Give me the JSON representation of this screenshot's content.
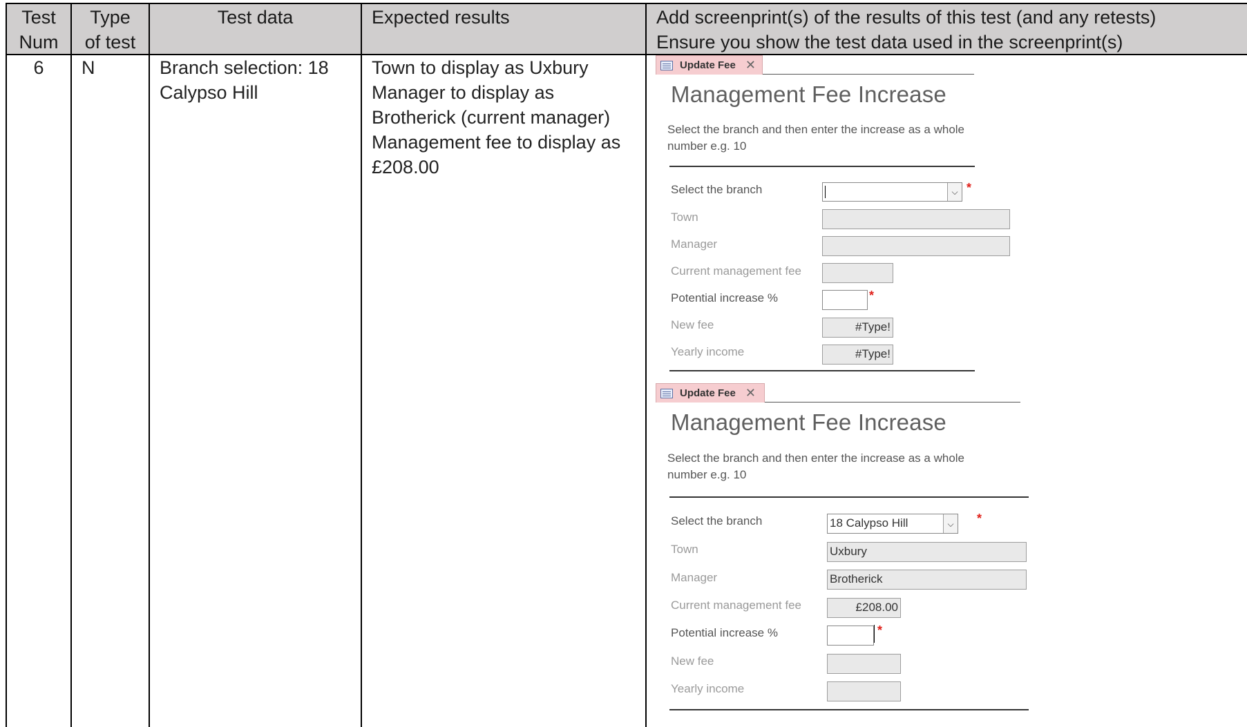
{
  "table": {
    "headers": {
      "test_num_line1": "Test",
      "test_num_line2": "Num",
      "type_line1": "Type",
      "type_line2": "of test",
      "test_data": "Test data",
      "expected_results": "Expected results",
      "screenprint_line1": "Add screenprint(s) of the results of this test (and any retests)",
      "screenprint_line2": "Ensure you show the test data used in the screenprint(s)"
    },
    "row": {
      "test_num": "6",
      "type": "N",
      "test_data_line1": "Branch selection: 18",
      "test_data_line2": "Calypso Hill",
      "expected_line1": "Town to display as Uxbury",
      "expected_line2": "Manager to display as",
      "expected_line3": "Brotherick (current manager)",
      "expected_line4": "Management fee to display as",
      "expected_line5": "£208.00"
    }
  },
  "screenshot1": {
    "tab_label": "Update Fee",
    "title": "Management Fee Increase",
    "desc_line1": "Select the branch and then enter the increase as a whole",
    "desc_line2": "number e.g. 10",
    "labels": {
      "branch": "Select the branch",
      "town": "Town",
      "manager": "Manager",
      "current_fee": "Current management fee",
      "increase": "Potential increase %",
      "new_fee": "New fee",
      "yearly_income": "Yearly income"
    },
    "values": {
      "branch": "",
      "town": "",
      "manager": "",
      "current_fee": "",
      "increase": "",
      "new_fee": "#Type!",
      "yearly_income": "#Type!"
    },
    "required_mark": "*"
  },
  "screenshot2": {
    "tab_label": "Update Fee",
    "title": "Management Fee Increase",
    "desc_line1": "Select the branch and then enter the increase as a whole",
    "desc_line2": "number e.g. 10",
    "labels": {
      "branch": "Select the branch",
      "town": "Town",
      "manager": "Manager",
      "current_fee": "Current management fee",
      "increase": "Potential increase %",
      "new_fee": "New fee",
      "yearly_income": "Yearly income"
    },
    "values": {
      "branch": "18 Calypso Hill",
      "town": "Uxbury",
      "manager": "Brotherick",
      "current_fee": "£208.00",
      "increase": "",
      "new_fee": "",
      "yearly_income": ""
    },
    "required_mark": "*"
  },
  "icons": {
    "form_tab": "form-icon",
    "close": "close-icon",
    "dropdown": "chevron-down-icon"
  },
  "colors": {
    "header_bg": "#d0cece",
    "tab_bg": "#f6cdd0",
    "required": "#e0201a"
  }
}
